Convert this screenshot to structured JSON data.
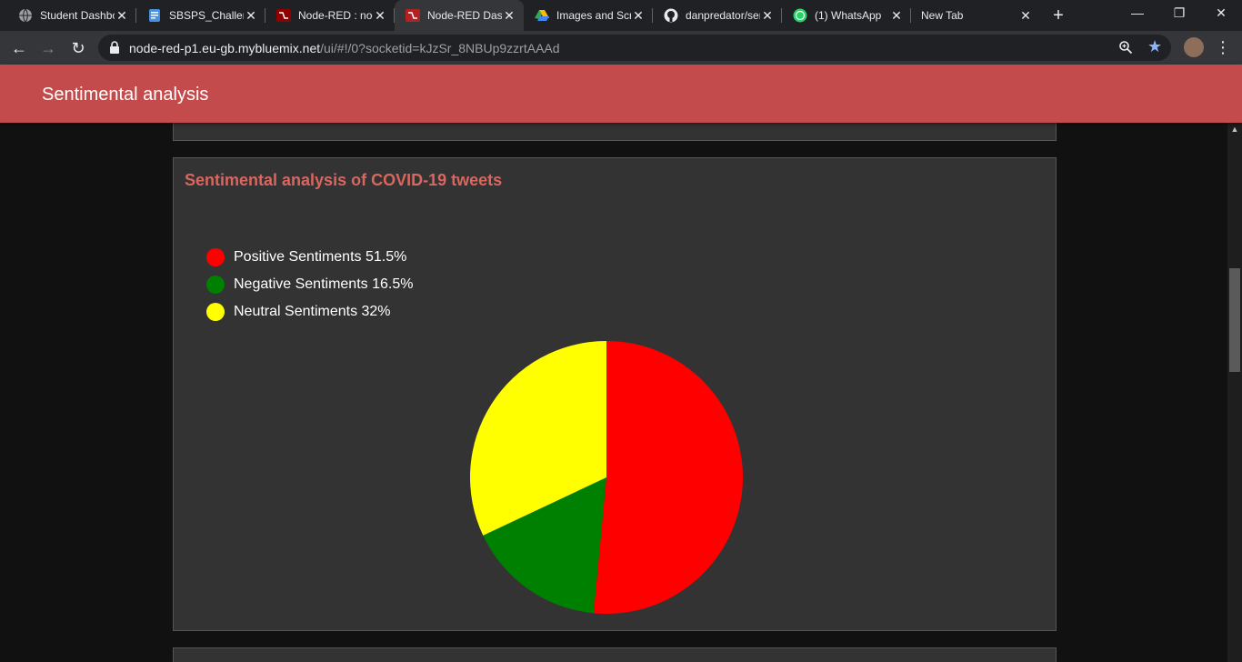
{
  "browser": {
    "tabs": [
      {
        "title": "Student Dashboard",
        "icon": "globe-icon"
      },
      {
        "title": "SBSPS_Challenge",
        "icon": "doc-icon"
      },
      {
        "title": "Node-RED : node",
        "icon": "node-red-icon"
      },
      {
        "title": "Node-RED Dashboard",
        "icon": "node-red-icon",
        "active": true
      },
      {
        "title": "Images and Screenshots",
        "icon": "drive-icon"
      },
      {
        "title": "danpredator/sentiment",
        "icon": "github-icon"
      },
      {
        "title": "(1) WhatsApp",
        "icon": "whatsapp-icon"
      },
      {
        "title": "New Tab",
        "icon": ""
      }
    ],
    "url_host": "node-red-p1.eu-gb.mybluemix.net",
    "url_path": "/ui/#!/0?socketid=kJzSr_8NBUp9zzrtAAAd"
  },
  "header": {
    "title": "Sentimental analysis"
  },
  "card": {
    "title": "Sentimental analysis of COVID-19 tweets"
  },
  "chart_data": {
    "type": "pie",
    "title": "Sentimental analysis of COVID-19 tweets",
    "legend_position": "top-left",
    "slices": [
      {
        "label": "Positive Sentiments 51.5%",
        "value": 51.5,
        "color": "#ff0000"
      },
      {
        "label": "Negative Sentiments 16.5%",
        "value": 16.5,
        "color": "#008000"
      },
      {
        "label": "Neutral Sentiments 32%",
        "value": 32,
        "color": "#ffff00"
      }
    ]
  }
}
